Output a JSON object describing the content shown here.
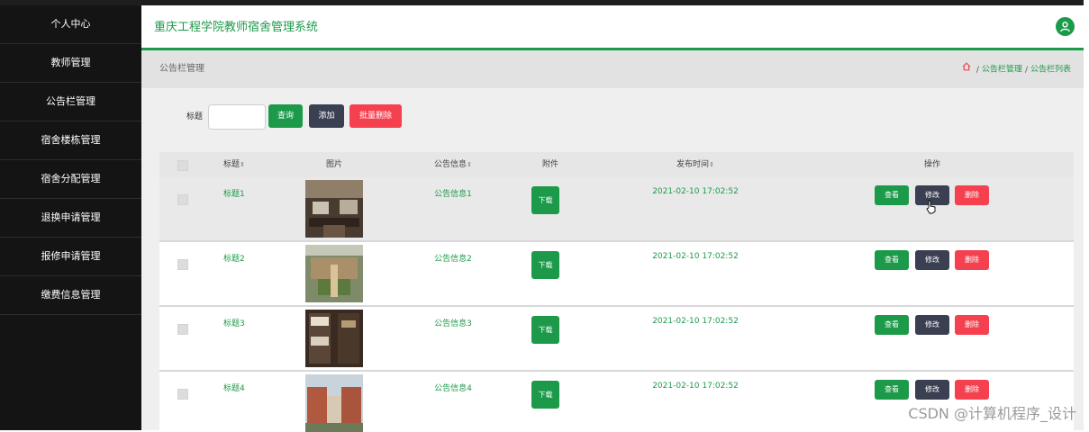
{
  "sidebar": {
    "items": [
      {
        "label": "个人中心"
      },
      {
        "label": "教师管理"
      },
      {
        "label": "公告栏管理"
      },
      {
        "label": "宿舍楼栋管理"
      },
      {
        "label": "宿舍分配管理"
      },
      {
        "label": "退换申请管理"
      },
      {
        "label": "报修申请管理"
      },
      {
        "label": "缴费信息管理"
      }
    ]
  },
  "header": {
    "title": "重庆工程学院教师宿舍管理系统",
    "avatar_icon": "user-icon"
  },
  "page": {
    "title": "公告栏管理",
    "breadcrumb": [
      "公告栏管理",
      "公告栏列表"
    ],
    "breadcrumb_sep": "/",
    "home_icon": "home-icon"
  },
  "search": {
    "label": "标题",
    "value": "",
    "placeholder": "",
    "query_label": "查询",
    "add_label": "添加",
    "batch_delete_label": "批量删除"
  },
  "table": {
    "columns": {
      "title": "标题",
      "image": "图片",
      "info": "公告信息",
      "attachment": "附件",
      "time": "发布时间",
      "actions": "操作",
      "sort_glyph": "⇕"
    },
    "rows": [
      {
        "title": "标题1",
        "info": "公告信息1",
        "time": "2021-02-10 17:02:52",
        "download": "下载",
        "view": "查看",
        "edit": "修改",
        "delete": "删除"
      },
      {
        "title": "标题2",
        "info": "公告信息2",
        "time": "2021-02-10 17:02:52",
        "download": "下载",
        "view": "查看",
        "edit": "修改",
        "delete": "删除"
      },
      {
        "title": "标题3",
        "info": "公告信息3",
        "time": "2021-02-10 17:02:52",
        "download": "下载",
        "view": "查看",
        "edit": "修改",
        "delete": "删除"
      },
      {
        "title": "标题4",
        "info": "公告信息4",
        "time": "2021-02-10 17:02:52",
        "download": "下载",
        "view": "查看",
        "edit": "修改",
        "delete": "删除"
      }
    ]
  },
  "colors": {
    "accent": "#1c9a4a",
    "dark_button": "#3a3f51",
    "danger": "#f5404f",
    "sidebar_bg": "#141414"
  },
  "watermark": "CSDN @计算机程序_设计"
}
